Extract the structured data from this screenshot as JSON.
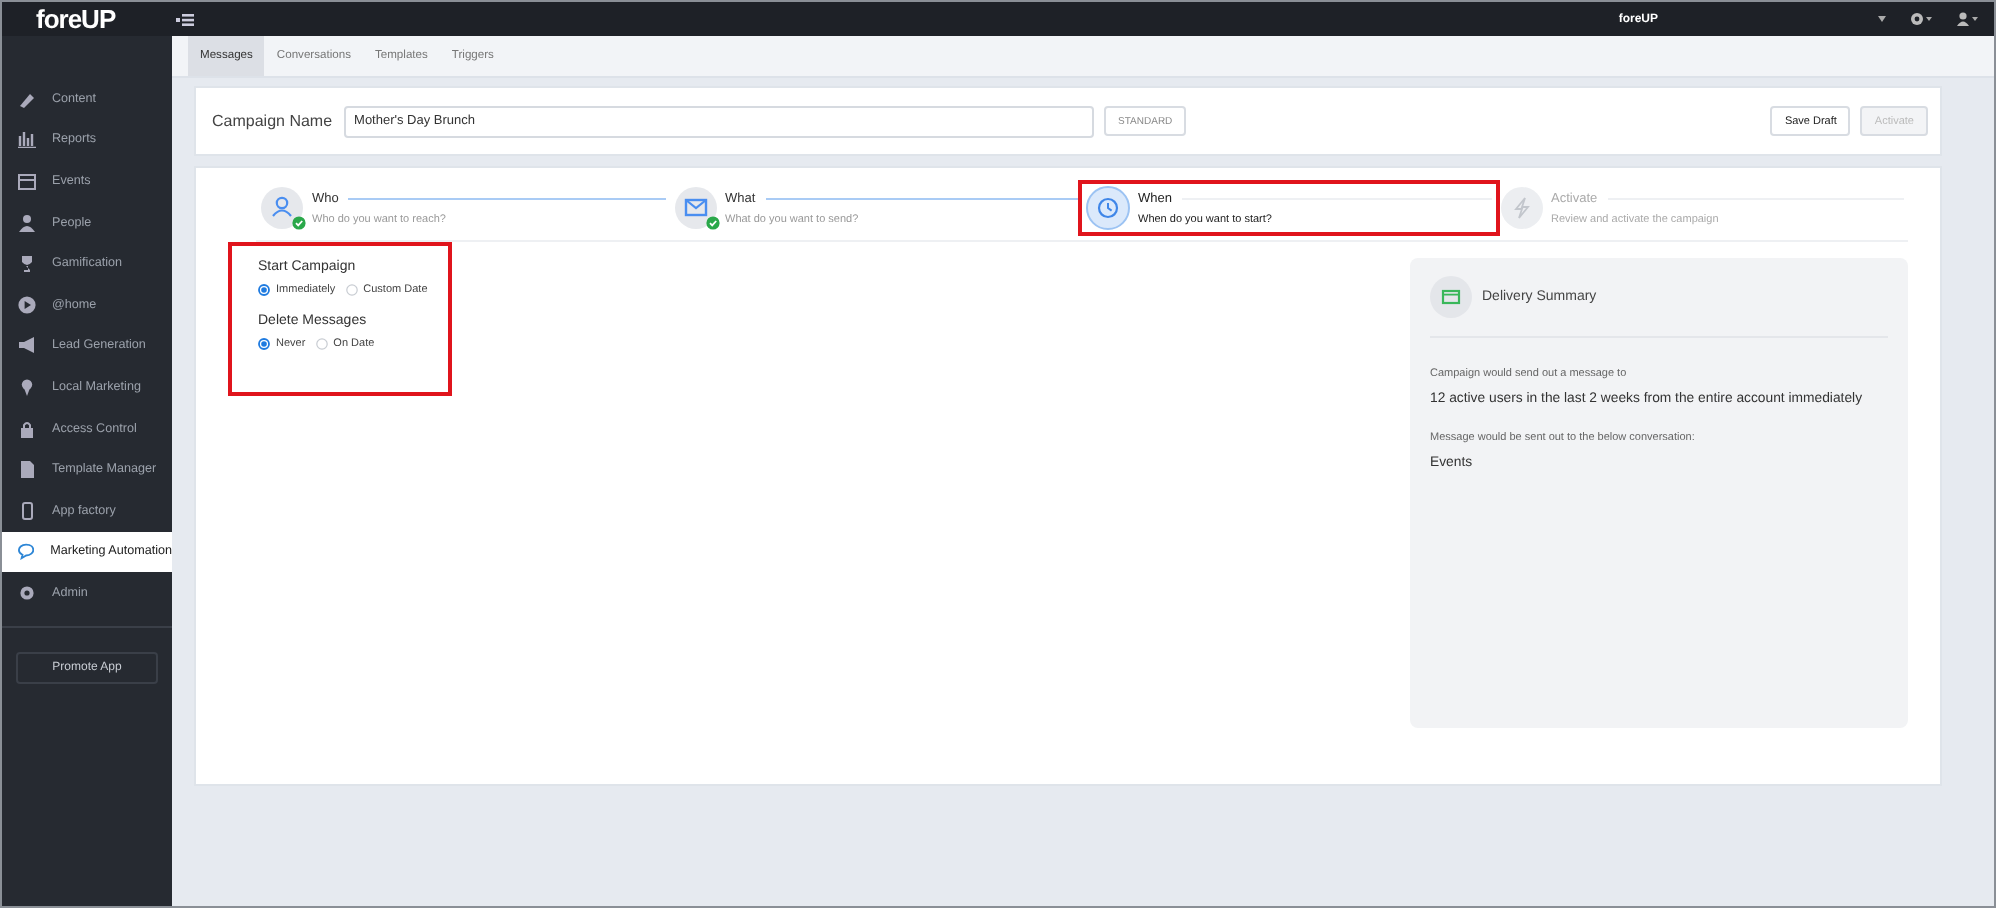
{
  "topbar": {
    "logo": "foreUP",
    "center_title": "foreUP"
  },
  "sidebar": {
    "items": [
      {
        "label": "Content",
        "selected": false
      },
      {
        "label": "Reports",
        "selected": false
      },
      {
        "label": "Events",
        "selected": false
      },
      {
        "label": "People",
        "selected": false
      },
      {
        "label": "Gamification",
        "selected": false
      },
      {
        "label": "@home",
        "selected": false
      },
      {
        "label": "Lead Generation",
        "selected": false
      },
      {
        "label": "Local Marketing",
        "selected": false
      },
      {
        "label": "Access Control",
        "selected": false
      },
      {
        "label": "Template Manager",
        "selected": false
      },
      {
        "label": "App factory",
        "selected": false
      },
      {
        "label": "Marketing Automation",
        "selected": true
      },
      {
        "label": "Admin",
        "selected": false
      }
    ],
    "promote_button": "Promote App"
  },
  "tabs": [
    {
      "label": "Messages",
      "selected": true
    },
    {
      "label": "Conversations",
      "selected": false
    },
    {
      "label": "Templates",
      "selected": false
    },
    {
      "label": "Triggers",
      "selected": false
    }
  ],
  "campaign": {
    "label": "Campaign Name",
    "value": "Mother's Day Brunch",
    "type_button": "STANDARD",
    "save_button": "Save Draft",
    "activate_button": {
      "label": "Activate",
      "disabled": true
    }
  },
  "steps": [
    {
      "title": "Who",
      "subtitle": "Who do you want to reach?",
      "completed": true,
      "selected": false,
      "highlighted": false
    },
    {
      "title": "What",
      "subtitle": "What do you want to send?",
      "completed": true,
      "selected": false,
      "highlighted": false
    },
    {
      "title": "When",
      "subtitle": "When do you want to start?",
      "completed": false,
      "selected": true,
      "highlighted": true
    },
    {
      "title": "Activate",
      "subtitle": "Review and activate the campaign",
      "completed": false,
      "selected": false,
      "highlighted": false
    }
  ],
  "options": {
    "highlighted": true,
    "groups": [
      {
        "title": "Start Campaign",
        "choices": [
          {
            "label": "Immediately",
            "selected": true
          },
          {
            "label": "Custom Date",
            "selected": false
          }
        ]
      },
      {
        "title": "Delete Messages",
        "choices": [
          {
            "label": "Never",
            "selected": true
          },
          {
            "label": "On Date",
            "selected": false
          }
        ]
      }
    ]
  },
  "summary": {
    "title": "Delivery Summary",
    "lines": [
      {
        "kind": "caption",
        "text": "Campaign would send out a message to"
      },
      {
        "kind": "value",
        "text": "12 active users in the last 2 weeks from the entire account immediately"
      },
      {
        "kind": "caption",
        "text": "Message would be sent out to the below conversation:"
      },
      {
        "kind": "value",
        "text": "Events"
      }
    ]
  }
}
